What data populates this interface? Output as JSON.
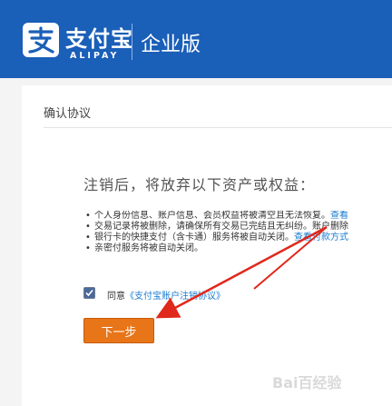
{
  "header": {
    "logo_cn": "支付宝",
    "logo_en": "ALIPAY",
    "edition": "企业版",
    "color": "#1a5fb8"
  },
  "page": {
    "section_title": "确认协议"
  },
  "notice": {
    "title": "注销后，将放弃以下资产或权益：",
    "items": [
      {
        "text": "个人身份信息、账户信息、会员权益将被清空且无法恢复。",
        "link": "查看"
      },
      {
        "text": "交易记录将被删除，请确保所有交易已完结且无纠纷。账户删除",
        "link": ""
      },
      {
        "text": "银行卡的快捷支付（含卡通）服务将被自动关闭。",
        "link": "查看付款方式"
      },
      {
        "text": "亲密付服务将被自动关闭。",
        "link": ""
      }
    ]
  },
  "agreement": {
    "prefix": "同意",
    "link": "《支付宝账户注销协议》",
    "checked": true
  },
  "next_button": {
    "label": "下一步",
    "color": "#e87518"
  },
  "watermark": "Bai百经验"
}
